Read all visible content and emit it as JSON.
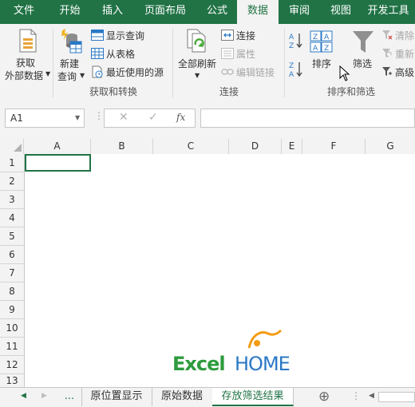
{
  "ribbon_tabs": [
    "文件",
    "开始",
    "插入",
    "页面布局",
    "公式",
    "数据",
    "审阅",
    "视图",
    "开发工具"
  ],
  "active_tab": "数据",
  "ribbon": {
    "get_data": {
      "line1": "获取",
      "line2": "外部数据"
    },
    "new_query": {
      "line1": "新建",
      "line2": "查询"
    },
    "show_queries": "显示查询",
    "from_table": "从表格",
    "recent_sources": "最近使用的源",
    "group_get_transform": "获取和转换",
    "refresh_all": "全部刷新",
    "connections": "连接",
    "properties": "属性",
    "edit_links": "编辑链接",
    "group_connections": "连接",
    "sort": "排序",
    "filter": "筛选",
    "clear": "清除",
    "reapply": "重新",
    "advanced": "高级",
    "group_sort_filter": "排序和筛选"
  },
  "formula_bar": {
    "name_box": "A1",
    "fx": "fx",
    "formula": ""
  },
  "columns": [
    "A",
    "B",
    "C",
    "D",
    "E",
    "F",
    "G"
  ],
  "rows": [
    "1",
    "2",
    "3",
    "4",
    "5",
    "6",
    "7",
    "8",
    "9",
    "10",
    "11",
    "12",
    "13"
  ],
  "sheet_tabs": [
    "...",
    "原位置显示",
    "原始数据",
    "存放筛选结果"
  ],
  "active_sheet": "存放筛选结果",
  "watermark": {
    "excel": "Excel",
    "home": "HOME"
  },
  "colors": {
    "accent": "#217346",
    "ribbon_bg": "#f3f3f3",
    "icon_blue": "#2b78c5",
    "logo_orange": "#f39c12"
  }
}
